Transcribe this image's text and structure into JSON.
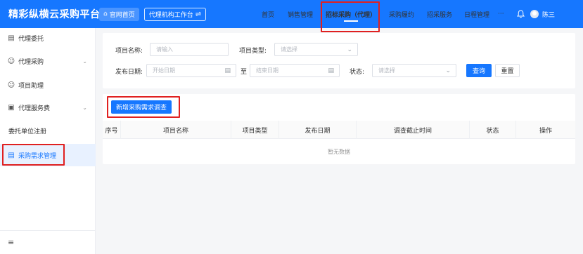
{
  "header": {
    "brand": "精彩纵横云采购平台",
    "home_label": "官网首页",
    "workspace_label": "代理机构工作台",
    "nav": [
      "首页",
      "销售管理",
      "招标采购（代理）",
      "采购履约",
      "招采服务",
      "日程管理"
    ],
    "nav_active": "招标采购（代理）",
    "more": "···",
    "username": "陈三"
  },
  "sidebar": {
    "items": [
      {
        "label": "代理委托",
        "icon": "document-icon"
      },
      {
        "label": "代理采购",
        "icon": "user-group-icon",
        "expandable": true
      },
      {
        "label": "项目助理",
        "icon": "user-icon"
      },
      {
        "label": "代理服务费",
        "icon": "fee-icon",
        "expandable": true
      },
      {
        "label": "委托单位注册",
        "icon": ""
      },
      {
        "label": "采购需求管理",
        "icon": "list-icon",
        "active": true
      }
    ],
    "collapse_icon": "menu-fold-icon"
  },
  "filters": {
    "project_name_label": "项目名称:",
    "project_name_placeholder": "请输入",
    "project_type_label": "项目类型:",
    "project_type_placeholder": "请选择",
    "publish_date_label": "发布日期:",
    "start_date_placeholder": "开始日期",
    "to_label": "至",
    "end_date_placeholder": "结束日期",
    "status_label": "状态:",
    "status_placeholder": "请选择",
    "query_label": "查询",
    "reset_label": "重置"
  },
  "actions": {
    "add_label": "新增采购需求调查"
  },
  "table": {
    "columns": [
      "序号",
      "项目名称",
      "项目类型",
      "发布日期",
      "调查截止时间",
      "状态",
      "操作"
    ],
    "empty_text": "暂无数据"
  },
  "colors": {
    "primary": "#1677ff",
    "highlight": "#e02020"
  }
}
